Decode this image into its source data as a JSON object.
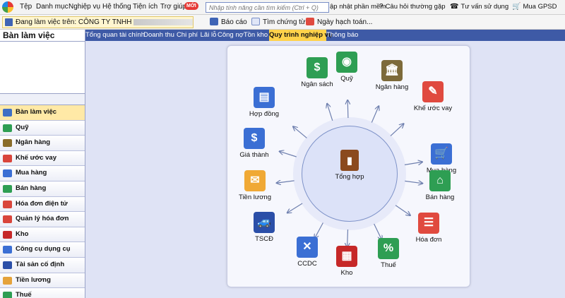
{
  "menu": {
    "items": [
      "Tệp",
      "Danh mục",
      "Nghiệp vụ",
      "Hệ thống",
      "Tiện ích",
      "Trợ giúp"
    ],
    "badge": "MỚI",
    "search_placeholder": "Nhập tính năng cần tìm kiếm (Ctrl + Q)",
    "right": {
      "update": "ập nhật phần mềm",
      "faq": "Câu hỏi thường gặp",
      "consult": "Tư vấn sử dụng",
      "buy": "Mua GPSD"
    }
  },
  "toolbar": {
    "company_label": "Đang làm việc trên: CÔNG TY TNHH",
    "report": "Báo cáo",
    "find_voucher": "Tìm chứng từ ...",
    "posting_date": "Ngày hạch toán..."
  },
  "left_panel": {
    "title": "Bàn làm việc",
    "items": [
      {
        "label": "Bàn làm việc",
        "icon": "dashboard-icon",
        "color": "#3f6fc4"
      },
      {
        "label": "Quỹ",
        "icon": "safe-icon",
        "color": "#2e9e53"
      },
      {
        "label": "Ngân hàng",
        "icon": "bank-icon",
        "color": "#8a6d2a"
      },
      {
        "label": "Khế ước vay",
        "icon": "loan-icon",
        "color": "#d9453b"
      },
      {
        "label": "Mua hàng",
        "icon": "cart-icon",
        "color": "#3b6fd4"
      },
      {
        "label": "Bán hàng",
        "icon": "store-icon",
        "color": "#2e9e53"
      },
      {
        "label": "Hóa đơn điện tử",
        "icon": "einvoice-icon",
        "color": "#d9453b"
      },
      {
        "label": "Quản lý hóa đơn",
        "icon": "invoice-icon",
        "color": "#d9453b"
      },
      {
        "label": "Kho",
        "icon": "warehouse-icon",
        "color": "#c62828"
      },
      {
        "label": "Công cụ dụng cụ",
        "icon": "tools-icon",
        "color": "#3b6fd4"
      },
      {
        "label": "Tài sản cố định",
        "icon": "car-icon",
        "color": "#2b4fa8"
      },
      {
        "label": "Tiền lương",
        "icon": "salary-icon",
        "color": "#e5a33b"
      },
      {
        "label": "Thuế",
        "icon": "tax-icon",
        "color": "#2e9e53"
      }
    ]
  },
  "tabs": [
    "Tổng quan tài chính",
    "Doanh thu",
    "Chi phí",
    "Lãi lỗ",
    "Công nợ",
    "Tồn kho",
    "Quy trình nghiệp vụ",
    "Thông báo"
  ],
  "active_tab": "Quy trình nghiệp vụ",
  "diagram": {
    "center": {
      "label": "Tổng hợp",
      "icon": "ledger-book-icon"
    },
    "nodes": [
      {
        "label": "Ngân sách",
        "icon": "money-bag-icon",
        "color": "#2e9e53",
        "glyph": "$"
      },
      {
        "label": "Quỹ",
        "icon": "safe-icon",
        "color": "#2e9e53",
        "glyph": "◉"
      },
      {
        "label": "Ngân hàng",
        "icon": "bank-icon",
        "color": "#7d6a3a",
        "glyph": "🏛"
      },
      {
        "label": "Khế ước vay",
        "icon": "loan-contract-icon",
        "color": "#e04a3f",
        "glyph": "✎"
      },
      {
        "label": "Mua hàng",
        "icon": "shopping-cart-icon",
        "color": "#3b6fd4",
        "glyph": "🛒"
      },
      {
        "label": "Bán hàng",
        "icon": "store-icon",
        "color": "#2e9e53",
        "glyph": "⌂"
      },
      {
        "label": "Hóa đơn",
        "icon": "invoice-icon",
        "color": "#e04a3f",
        "glyph": "☰"
      },
      {
        "label": "Thuế",
        "icon": "tax-percent-icon",
        "color": "#2e9e53",
        "glyph": "%"
      },
      {
        "label": "Kho",
        "icon": "warehouse-icon",
        "color": "#c62828",
        "glyph": "▦"
      },
      {
        "label": "CCDC",
        "icon": "tools-icon",
        "color": "#3b6fd4",
        "glyph": "✕"
      },
      {
        "label": "TSCĐ",
        "icon": "car-icon",
        "color": "#2b4fa8",
        "glyph": "🚙"
      },
      {
        "label": "Tiền lương",
        "icon": "salary-envelope-icon",
        "color": "#f0a935",
        "glyph": "✉"
      },
      {
        "label": "Giá thành",
        "icon": "cost-price-icon",
        "color": "#3b6fd4",
        "glyph": "$"
      },
      {
        "label": "Hợp đồng",
        "icon": "contract-icon",
        "color": "#3b6fd4",
        "glyph": "▤"
      }
    ]
  }
}
